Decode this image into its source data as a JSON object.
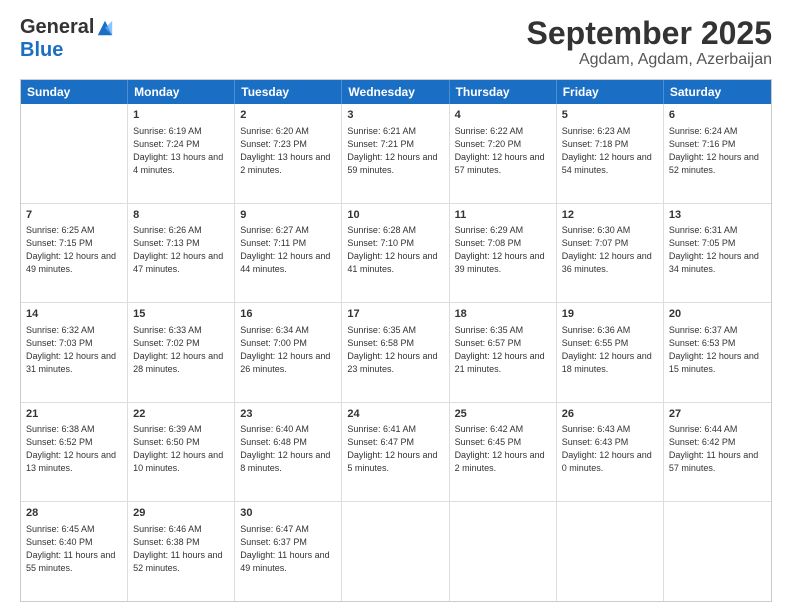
{
  "logo": {
    "general": "General",
    "blue": "Blue"
  },
  "header": {
    "title": "September 2025",
    "subtitle": "Agdam, Agdam, Azerbaijan"
  },
  "calendar": {
    "days": [
      "Sunday",
      "Monday",
      "Tuesday",
      "Wednesday",
      "Thursday",
      "Friday",
      "Saturday"
    ],
    "rows": [
      [
        {
          "day": "",
          "empty": true
        },
        {
          "day": "1",
          "sunrise": "Sunrise: 6:19 AM",
          "sunset": "Sunset: 7:24 PM",
          "daylight": "Daylight: 13 hours and 4 minutes."
        },
        {
          "day": "2",
          "sunrise": "Sunrise: 6:20 AM",
          "sunset": "Sunset: 7:23 PM",
          "daylight": "Daylight: 13 hours and 2 minutes."
        },
        {
          "day": "3",
          "sunrise": "Sunrise: 6:21 AM",
          "sunset": "Sunset: 7:21 PM",
          "daylight": "Daylight: 12 hours and 59 minutes."
        },
        {
          "day": "4",
          "sunrise": "Sunrise: 6:22 AM",
          "sunset": "Sunset: 7:20 PM",
          "daylight": "Daylight: 12 hours and 57 minutes."
        },
        {
          "day": "5",
          "sunrise": "Sunrise: 6:23 AM",
          "sunset": "Sunset: 7:18 PM",
          "daylight": "Daylight: 12 hours and 54 minutes."
        },
        {
          "day": "6",
          "sunrise": "Sunrise: 6:24 AM",
          "sunset": "Sunset: 7:16 PM",
          "daylight": "Daylight: 12 hours and 52 minutes."
        }
      ],
      [
        {
          "day": "7",
          "sunrise": "Sunrise: 6:25 AM",
          "sunset": "Sunset: 7:15 PM",
          "daylight": "Daylight: 12 hours and 49 minutes."
        },
        {
          "day": "8",
          "sunrise": "Sunrise: 6:26 AM",
          "sunset": "Sunset: 7:13 PM",
          "daylight": "Daylight: 12 hours and 47 minutes."
        },
        {
          "day": "9",
          "sunrise": "Sunrise: 6:27 AM",
          "sunset": "Sunset: 7:11 PM",
          "daylight": "Daylight: 12 hours and 44 minutes."
        },
        {
          "day": "10",
          "sunrise": "Sunrise: 6:28 AM",
          "sunset": "Sunset: 7:10 PM",
          "daylight": "Daylight: 12 hours and 41 minutes."
        },
        {
          "day": "11",
          "sunrise": "Sunrise: 6:29 AM",
          "sunset": "Sunset: 7:08 PM",
          "daylight": "Daylight: 12 hours and 39 minutes."
        },
        {
          "day": "12",
          "sunrise": "Sunrise: 6:30 AM",
          "sunset": "Sunset: 7:07 PM",
          "daylight": "Daylight: 12 hours and 36 minutes."
        },
        {
          "day": "13",
          "sunrise": "Sunrise: 6:31 AM",
          "sunset": "Sunset: 7:05 PM",
          "daylight": "Daylight: 12 hours and 34 minutes."
        }
      ],
      [
        {
          "day": "14",
          "sunrise": "Sunrise: 6:32 AM",
          "sunset": "Sunset: 7:03 PM",
          "daylight": "Daylight: 12 hours and 31 minutes."
        },
        {
          "day": "15",
          "sunrise": "Sunrise: 6:33 AM",
          "sunset": "Sunset: 7:02 PM",
          "daylight": "Daylight: 12 hours and 28 minutes."
        },
        {
          "day": "16",
          "sunrise": "Sunrise: 6:34 AM",
          "sunset": "Sunset: 7:00 PM",
          "daylight": "Daylight: 12 hours and 26 minutes."
        },
        {
          "day": "17",
          "sunrise": "Sunrise: 6:35 AM",
          "sunset": "Sunset: 6:58 PM",
          "daylight": "Daylight: 12 hours and 23 minutes."
        },
        {
          "day": "18",
          "sunrise": "Sunrise: 6:35 AM",
          "sunset": "Sunset: 6:57 PM",
          "daylight": "Daylight: 12 hours and 21 minutes."
        },
        {
          "day": "19",
          "sunrise": "Sunrise: 6:36 AM",
          "sunset": "Sunset: 6:55 PM",
          "daylight": "Daylight: 12 hours and 18 minutes."
        },
        {
          "day": "20",
          "sunrise": "Sunrise: 6:37 AM",
          "sunset": "Sunset: 6:53 PM",
          "daylight": "Daylight: 12 hours and 15 minutes."
        }
      ],
      [
        {
          "day": "21",
          "sunrise": "Sunrise: 6:38 AM",
          "sunset": "Sunset: 6:52 PM",
          "daylight": "Daylight: 12 hours and 13 minutes."
        },
        {
          "day": "22",
          "sunrise": "Sunrise: 6:39 AM",
          "sunset": "Sunset: 6:50 PM",
          "daylight": "Daylight: 12 hours and 10 minutes."
        },
        {
          "day": "23",
          "sunrise": "Sunrise: 6:40 AM",
          "sunset": "Sunset: 6:48 PM",
          "daylight": "Daylight: 12 hours and 8 minutes."
        },
        {
          "day": "24",
          "sunrise": "Sunrise: 6:41 AM",
          "sunset": "Sunset: 6:47 PM",
          "daylight": "Daylight: 12 hours and 5 minutes."
        },
        {
          "day": "25",
          "sunrise": "Sunrise: 6:42 AM",
          "sunset": "Sunset: 6:45 PM",
          "daylight": "Daylight: 12 hours and 2 minutes."
        },
        {
          "day": "26",
          "sunrise": "Sunrise: 6:43 AM",
          "sunset": "Sunset: 6:43 PM",
          "daylight": "Daylight: 12 hours and 0 minutes."
        },
        {
          "day": "27",
          "sunrise": "Sunrise: 6:44 AM",
          "sunset": "Sunset: 6:42 PM",
          "daylight": "Daylight: 11 hours and 57 minutes."
        }
      ],
      [
        {
          "day": "28",
          "sunrise": "Sunrise: 6:45 AM",
          "sunset": "Sunset: 6:40 PM",
          "daylight": "Daylight: 11 hours and 55 minutes."
        },
        {
          "day": "29",
          "sunrise": "Sunrise: 6:46 AM",
          "sunset": "Sunset: 6:38 PM",
          "daylight": "Daylight: 11 hours and 52 minutes."
        },
        {
          "day": "30",
          "sunrise": "Sunrise: 6:47 AM",
          "sunset": "Sunset: 6:37 PM",
          "daylight": "Daylight: 11 hours and 49 minutes."
        },
        {
          "day": "",
          "empty": true
        },
        {
          "day": "",
          "empty": true
        },
        {
          "day": "",
          "empty": true
        },
        {
          "day": "",
          "empty": true
        }
      ]
    ]
  }
}
